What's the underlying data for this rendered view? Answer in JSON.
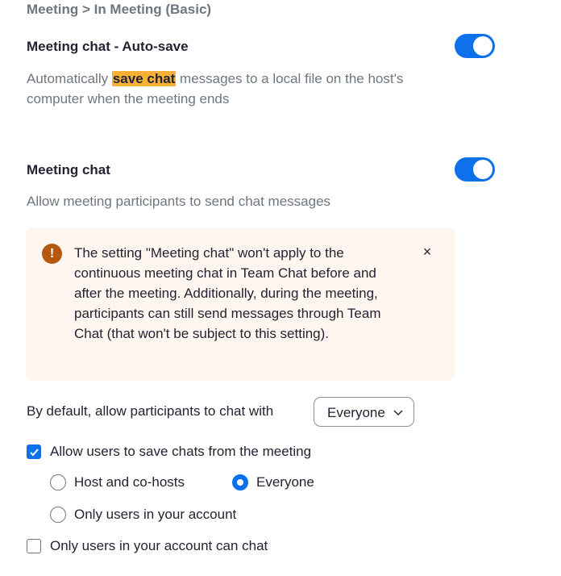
{
  "breadcrumb": "Meeting > In Meeting (Basic)",
  "colors": {
    "accent": "#0e71eb",
    "highlight": "#f7b136",
    "notice_bg": "#fff6ef",
    "notice_icon": "#b5570f"
  },
  "autosave": {
    "title": "Meeting chat - Auto-save",
    "desc_before": "Automatically ",
    "desc_highlight": "save chat",
    "desc_after": " messages to a local file on the host's computer when the meeting ends",
    "enabled": true
  },
  "meeting_chat": {
    "title": "Meeting chat",
    "desc": "Allow meeting participants to send chat messages",
    "enabled": true
  },
  "notice": {
    "icon": "warning-icon",
    "icon_glyph": "!",
    "text": "The setting \"Meeting chat\" won't apply to the continuous meeting chat in Team Chat before and after the meeting. Additionally, during the meeting, participants can still send messages through Team Chat (that won't be subject to this setting).",
    "close_glyph": "×"
  },
  "default_chat": {
    "label": "By default, allow participants to chat with",
    "selected": "Everyone"
  },
  "save_chats": {
    "label": "Allow users to save chats from the meeting",
    "checked": true,
    "options": [
      {
        "label": "Host and co-hosts",
        "selected": false
      },
      {
        "label": "Everyone",
        "selected": true
      },
      {
        "label": "Only users in your account",
        "selected": false
      }
    ]
  },
  "account_only": {
    "label": "Only users in your account can chat",
    "checked": false
  }
}
